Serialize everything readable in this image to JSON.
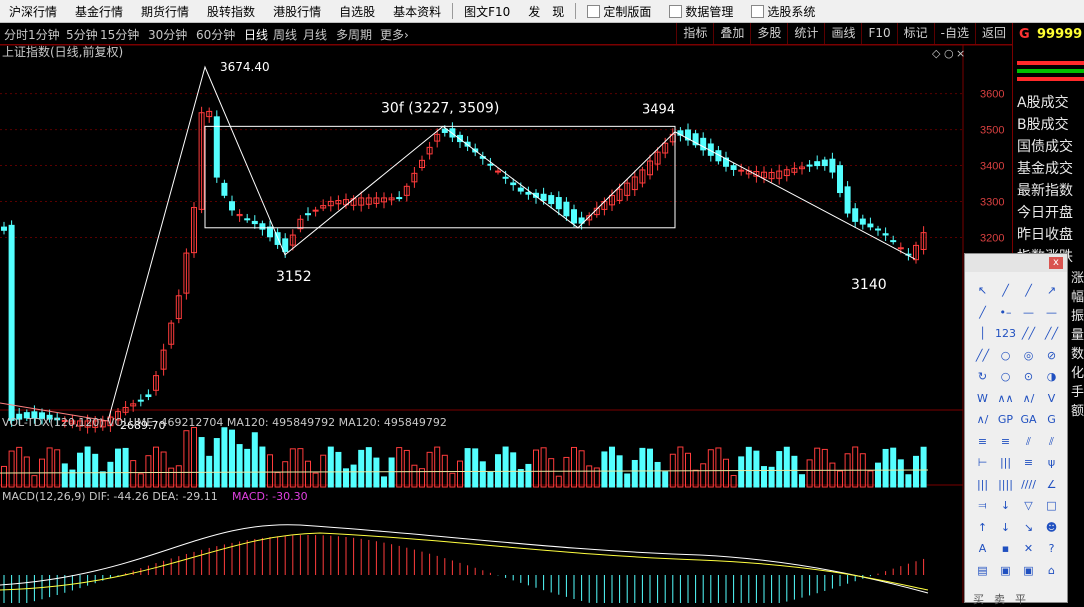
{
  "menubar": {
    "items": [
      "沪深行情",
      "基金行情",
      "期货行情",
      "股转指数",
      "港股行情",
      "自选股",
      "基本资料",
      "图文F10",
      "发　现"
    ],
    "extra": [
      "定制版面",
      "数据管理",
      "选股系统"
    ]
  },
  "periods": {
    "items": [
      "分时",
      "1分钟",
      "5分钟",
      "15分钟",
      "30分钟",
      "60分钟",
      "日线",
      "周线",
      "月线",
      "多周期",
      "更多"
    ],
    "active": "日线",
    "more_arrow": "›"
  },
  "toolbar": {
    "items": [
      "指标",
      "叠加",
      "多股",
      "统计",
      "画线",
      "F10",
      "标记",
      "-自选",
      "返回"
    ]
  },
  "chart_title": "上证指数(日线,前复权)",
  "window_buttons": [
    "◇",
    "○",
    "×"
  ],
  "annotations": {
    "peak": "3674.40",
    "low": "2689.70",
    "box": "30f (3227, 3509)",
    "right_peak": "3494",
    "left_low": "3152",
    "right_low": "3140"
  },
  "price_axis": {
    "ticks": [
      "3600",
      "3500",
      "3400",
      "3300",
      "3200"
    ]
  },
  "volume": {
    "label": "VOL-TDX(120,120)",
    "text": "VOLUME: 469212704  MA120: 495849792  MA120: 495849792"
  },
  "macd": {
    "label": "MACD(12,26,9)",
    "dif": "DIF: -44.26",
    "dea": "DEA: -29.11",
    "macd": "MACD: -30.30"
  },
  "right_panel": {
    "code_prefix": "G",
    "code_value": "99999",
    "labels": [
      "A股成交",
      "B股成交",
      "国债成交",
      "基金成交",
      "最新指数",
      "今日开盘",
      "昨日收盘",
      "指数涨跌"
    ],
    "vertical_text": [
      "涨",
      "幅",
      "振",
      "量",
      "数",
      "化",
      "手",
      "额"
    ]
  },
  "colors": {
    "up": "#ff3c3c",
    "down": "#54ffff",
    "frame": "#7a0000"
  },
  "drawing_tools": {
    "close": "x",
    "icons": [
      "↖",
      "╱",
      "╱",
      "↗",
      "╱",
      "•–",
      "—",
      "—",
      "│",
      "123",
      "╱╱",
      "╱╱",
      "╱╱",
      "○",
      "◎",
      "⊘",
      "↻",
      "○",
      "⊙",
      "◑",
      "W",
      "∧∧",
      "∧/",
      "V",
      "∧/",
      "GP",
      "GA",
      "G",
      "≡",
      "≡",
      "⫽",
      "⫽",
      "⊢",
      "|||",
      "≡",
      "ψ",
      "|||",
      "||||",
      "////",
      "∠",
      "⫤",
      "↓",
      "▽",
      "□",
      "↑",
      "↓",
      "↘",
      "☻",
      "A",
      "▪",
      "✕",
      "?",
      "▤",
      "▣",
      "▣",
      "⌂"
    ],
    "bottom": "买卖平"
  },
  "chart_data": {
    "type": "candlestick",
    "price_axis_ticks": [
      3600,
      3500,
      3400,
      3300,
      3200
    ],
    "annotated_high": 3674.4,
    "annotated_low": 2689.7,
    "box_range": [
      3227,
      3509
    ],
    "box_label": "30f (3227, 3509)",
    "swing_labels": [
      3152,
      3494,
      3140
    ],
    "volume_ma120": 495849792,
    "volume_last": 469212704,
    "macd": {
      "dif": -44.26,
      "dea": -29.11,
      "macd": -30.3
    }
  }
}
